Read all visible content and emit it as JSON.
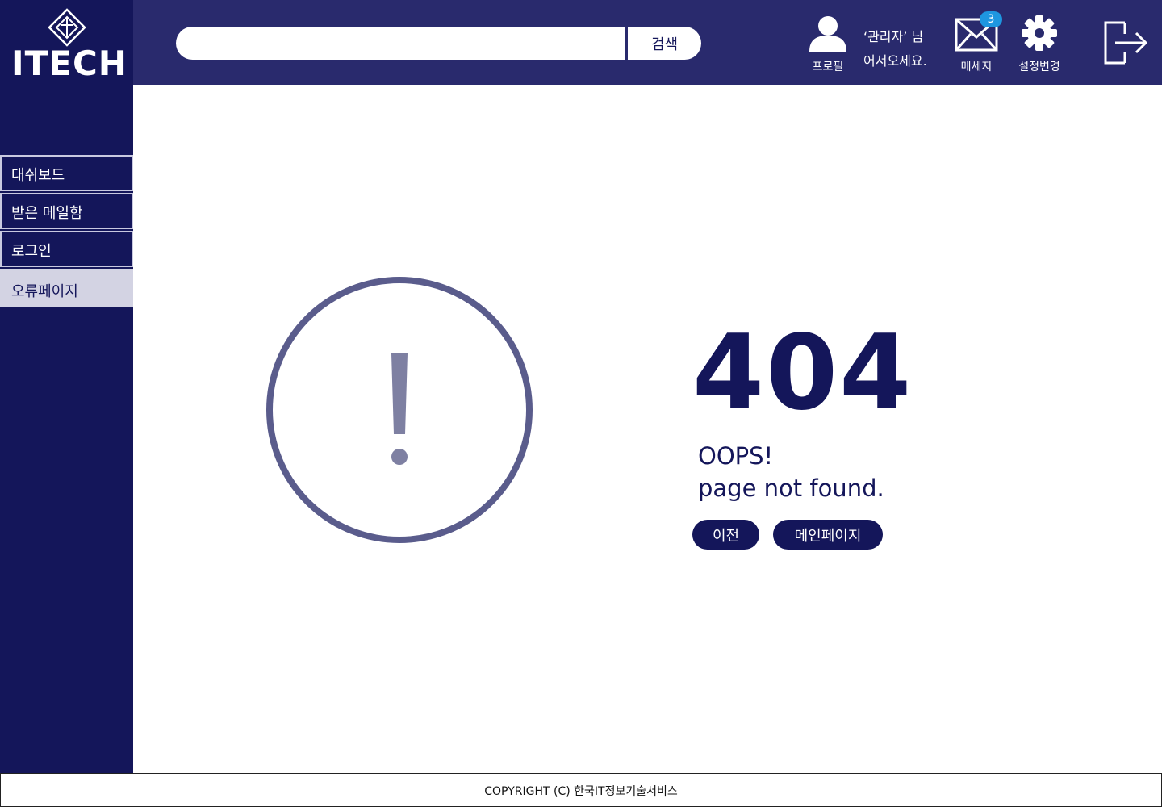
{
  "brand": {
    "logo_text": "ITECH"
  },
  "sidebar": {
    "items": [
      {
        "label": "대쉬보드"
      },
      {
        "label": "받은 메일함"
      },
      {
        "label": "로그인"
      },
      {
        "label": "오류페이지",
        "active": true
      }
    ]
  },
  "header": {
    "search": {
      "value": "",
      "placeholder": "",
      "button_label": "검색"
    },
    "profile_label": "프로필",
    "welcome_line1": "‘관리자’ 님",
    "welcome_line2": "어서오세요.",
    "message_label": "메세지",
    "message_count": "3",
    "settings_label": "설정변경",
    "logout_icon": "logout-icon"
  },
  "error": {
    "code": "404",
    "line1": "OOPS!",
    "line2": "page not found.",
    "prev_label": "이전",
    "main_label": "메인페이지"
  },
  "footer": {
    "copyright": "COPYRIGHT (C) 한국IT정보기술서비스"
  },
  "colors": {
    "sidebar": "#14165a",
    "header": "#292a6d",
    "active_item": "#d3d3e3",
    "badge": "#1e96e0",
    "circle": "#5a5c8c"
  }
}
